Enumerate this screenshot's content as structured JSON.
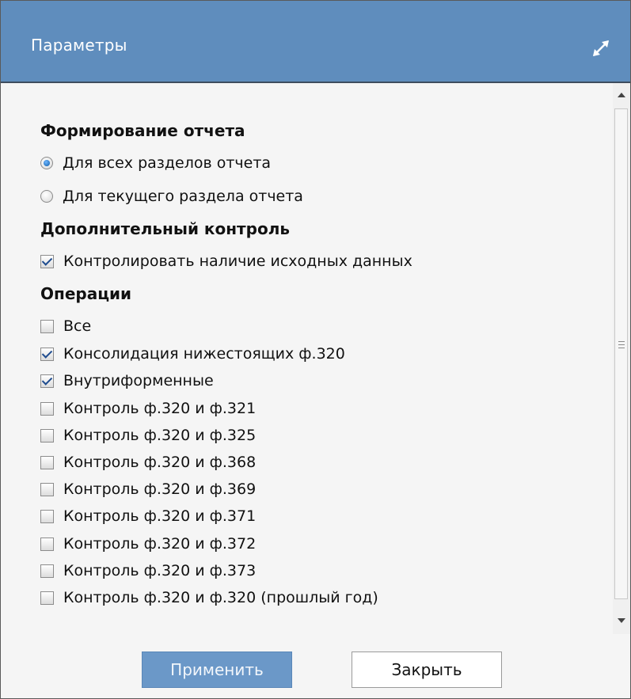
{
  "window": {
    "title": "Параметры",
    "maximize_icon": "expand-arrows-icon"
  },
  "colors": {
    "titlebar": "#5f8dbd",
    "apply_button": "#6b98c8",
    "check_mark": "#1f4c8f"
  },
  "report_generation": {
    "heading": "Формирование отчета",
    "options": [
      {
        "label": "Для всех разделов отчета",
        "selected": true
      },
      {
        "label": "Для текущего раздела отчета",
        "selected": false
      }
    ]
  },
  "additional_control": {
    "heading": "Дополнительный контроль",
    "options": [
      {
        "label": "Контролировать наличие исходных данных",
        "checked": true
      }
    ]
  },
  "operations": {
    "heading": "Операции",
    "items": [
      {
        "label": "Все",
        "checked": false
      },
      {
        "label": "Консолидация нижестоящих ф.320",
        "checked": true
      },
      {
        "label": "Внутриформенные",
        "checked": true
      },
      {
        "label": "Контроль ф.320 и ф.321",
        "checked": false
      },
      {
        "label": "Контроль ф.320 и ф.325",
        "checked": false
      },
      {
        "label": "Контроль ф.320 и ф.368",
        "checked": false
      },
      {
        "label": "Контроль ф.320 и ф.369",
        "checked": false
      },
      {
        "label": "Контроль ф.320 и ф.371",
        "checked": false
      },
      {
        "label": "Контроль ф.320 и ф.372",
        "checked": false
      },
      {
        "label": "Контроль ф.320 и ф.373",
        "checked": false
      },
      {
        "label": "Контроль ф.320 и ф.320 (прошлый год)",
        "checked": false
      }
    ]
  },
  "footer": {
    "apply_label": "Применить",
    "close_label": "Закрыть"
  }
}
